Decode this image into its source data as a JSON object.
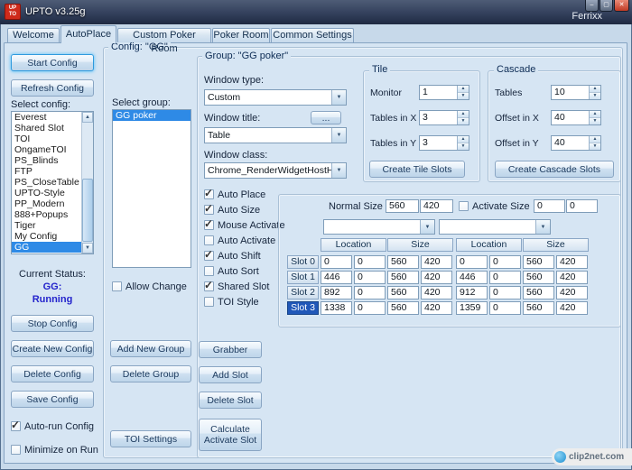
{
  "titlebar": {
    "title": "UPTO  v3.25g",
    "app_icon_line1": "UP",
    "app_icon_line2": "TO",
    "minimize_glyph": "–",
    "maximize_glyph": "▢",
    "close_glyph": "✕",
    "background_text": "Ferrixx"
  },
  "tabs": [
    {
      "label": "Welcome",
      "active": false
    },
    {
      "label": "AutoPlace",
      "active": true
    },
    {
      "label": "Custom Poker Room",
      "active": false
    },
    {
      "label": "Poker Room",
      "active": false
    },
    {
      "label": "Common Settings",
      "active": false
    }
  ],
  "left_panel": {
    "start_button": "Start Config",
    "refresh_button": "Refresh Config",
    "select_config_label": "Select config:",
    "configs": [
      {
        "label": "Everest",
        "selected": false
      },
      {
        "label": "Shared Slot",
        "selected": false
      },
      {
        "label": "TOI",
        "selected": false
      },
      {
        "label": "OngameTOI",
        "selected": false
      },
      {
        "label": "PS_Blinds",
        "selected": false
      },
      {
        "label": "FTP",
        "selected": false
      },
      {
        "label": "PS_CloseTable",
        "selected": false
      },
      {
        "label": "UPTO-Style",
        "selected": false
      },
      {
        "label": "PP_Modern",
        "selected": false
      },
      {
        "label": "888+Popups",
        "selected": false
      },
      {
        "label": "Tiger",
        "selected": false
      },
      {
        "label": "My Config",
        "selected": false
      },
      {
        "label": "GG",
        "selected": true
      }
    ],
    "current_status_label": "Current Status:",
    "status_name": "GG:",
    "status_value": "Running",
    "stop_button": "Stop Config",
    "create_button": "Create New Config",
    "delete_button": "Delete Config",
    "save_button": "Save Config",
    "autorun": {
      "label": "Auto-run Config",
      "checked": true
    },
    "minimize": {
      "label": "Minimize on Run",
      "checked": false
    }
  },
  "config_group": {
    "title": "Config: \"GG\"",
    "select_group_label": "Select group:",
    "groups": [
      {
        "label": "GG poker",
        "selected": true
      }
    ],
    "allow_change": {
      "label": "Allow Change",
      "checked": false
    },
    "add_group_button": "Add New Group",
    "delete_group_button": "Delete Group",
    "toi_settings_button": "TOI Settings"
  },
  "group_panel": {
    "title": "Group: \"GG poker\"",
    "window_type_label": "Window type:",
    "window_type_value": "Custom",
    "window_title_label": "Window title:",
    "window_title_browse": "...",
    "window_title_value": "Table",
    "window_class_label": "Window class:",
    "window_class_value": "Chrome_RenderWidgetHostHWl",
    "checkboxes": [
      {
        "label": "Auto Place",
        "checked": true
      },
      {
        "label": "Auto Size",
        "checked": true
      },
      {
        "label": "Mouse Activate",
        "checked": true
      },
      {
        "label": "Auto Activate",
        "checked": false
      },
      {
        "label": "Auto Shift",
        "checked": true
      },
      {
        "label": "Auto Sort",
        "checked": false
      },
      {
        "label": "Shared Slot",
        "checked": true
      },
      {
        "label": "TOI Style",
        "checked": false
      }
    ],
    "grabber_button": "Grabber",
    "add_slot_button": "Add Slot",
    "delete_slot_button": "Delete Slot",
    "calculate_button": "Calculate Activate Slot"
  },
  "tile": {
    "title": "Tile",
    "fields": [
      {
        "label": "Monitor",
        "value": "1"
      },
      {
        "label": "Tables in X",
        "value": "3"
      },
      {
        "label": "Tables in Y",
        "value": "3"
      }
    ],
    "button": "Create Tile Slots"
  },
  "cascade": {
    "title": "Cascade",
    "fields": [
      {
        "label": "Tables",
        "value": "10"
      },
      {
        "label": "Offset in X",
        "value": "40"
      },
      {
        "label": "Offset in Y",
        "value": "40"
      }
    ],
    "button": "Create Cascade Slots"
  },
  "slots": {
    "normal_size_label": "Normal Size",
    "normal_w": "560",
    "normal_h": "420",
    "activate": {
      "label": "Activate Size",
      "checked": false
    },
    "activate_w": "0",
    "activate_h": "0",
    "combo_left_value": "",
    "combo_right_value": "",
    "headers": [
      "Location",
      "Size",
      "Location",
      "Size"
    ],
    "rows": [
      {
        "label": "Slot 0",
        "selected": false,
        "values": [
          "0",
          "0",
          "560",
          "420",
          "0",
          "0",
          "560",
          "420"
        ]
      },
      {
        "label": "Slot 1",
        "selected": false,
        "values": [
          "446",
          "0",
          "560",
          "420",
          "446",
          "0",
          "560",
          "420"
        ]
      },
      {
        "label": "Slot 2",
        "selected": false,
        "values": [
          "892",
          "0",
          "560",
          "420",
          "912",
          "0",
          "560",
          "420"
        ]
      },
      {
        "label": "Slot 3",
        "selected": true,
        "values": [
          "1338",
          "0",
          "560",
          "420",
          "1359",
          "0",
          "560",
          "420"
        ]
      }
    ]
  },
  "icons": {
    "dropdown": "▼",
    "spin_up": "▲",
    "spin_down": "▼",
    "scroll_up": "▲",
    "scroll_down": "▼"
  },
  "watermark": {
    "text": "clip2net.com"
  }
}
